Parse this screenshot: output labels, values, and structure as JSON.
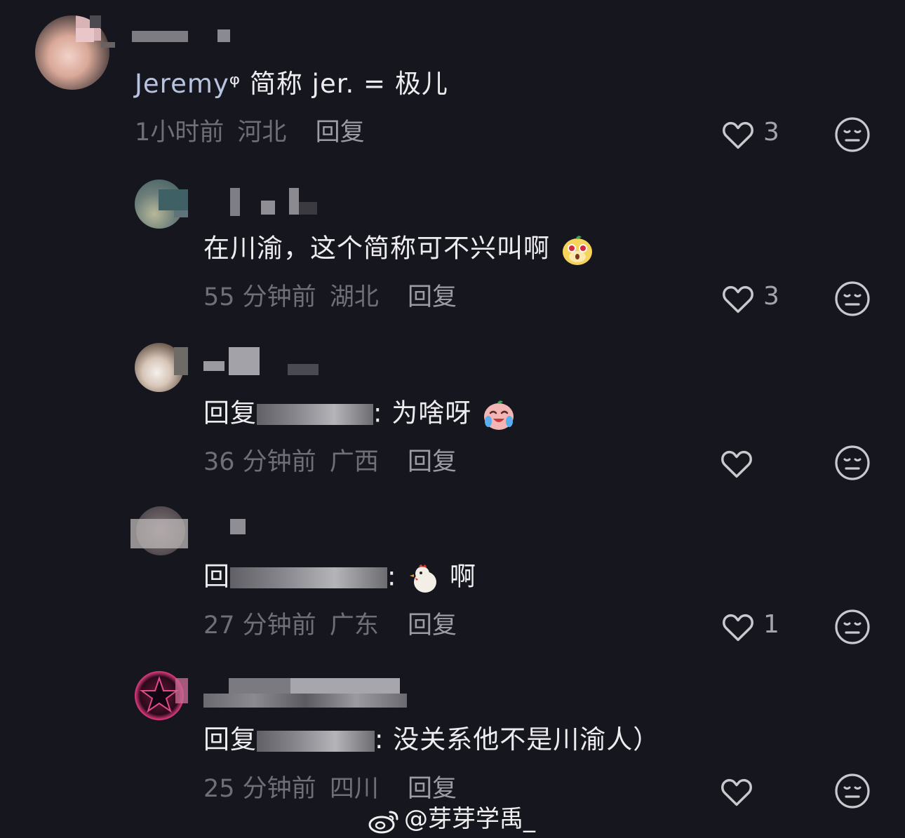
{
  "comments": [
    {
      "text_prefix": "Jeremy",
      "text_suffix": "ᵠ 简称 jer. = 极儿",
      "time": "1小时前",
      "location": "河北",
      "reply_label": "回复",
      "likes": "3"
    },
    {
      "text": "在川渝，这个简称可不兴叫啊",
      "time": "55 分钟前",
      "location": "湖北",
      "reply_label": "回复",
      "likes": "3"
    },
    {
      "text_prefix": "回复",
      "text_suffix": ": 为啥呀",
      "time": "36 分钟前",
      "location": "广西",
      "reply_label": "回复",
      "likes": ""
    },
    {
      "text_prefix": "回",
      "text_suffix": ": ",
      "text_tail": "啊",
      "time": "27 分钟前",
      "location": "广东",
      "reply_label": "回复",
      "likes": "1"
    },
    {
      "text_prefix": "回复",
      "text_suffix": ": 没关系他不是川渝人）",
      "time": "25 分钟前",
      "location": "四川",
      "reply_label": "回复",
      "likes": ""
    }
  ],
  "watermark": "@芽芽学禹_",
  "icons": {
    "like": "heart-outline-icon",
    "dislike": "meh-face-icon",
    "watermark": "weibo-logo-icon"
  },
  "colors": {
    "background": "#16161e",
    "text": "#ededf0",
    "meta": "#6f6f78",
    "accent": "#b8c3e0"
  }
}
